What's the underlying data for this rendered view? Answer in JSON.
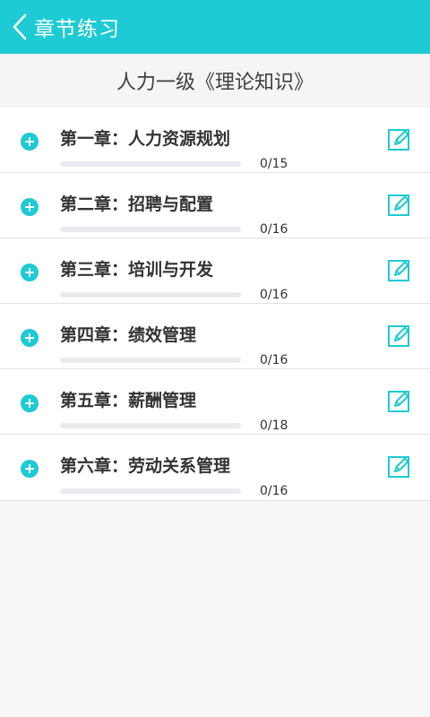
{
  "header": {
    "back_icon": "chevron-left-icon",
    "title": "章节练习"
  },
  "subtitle": "人力一级《理论知识》",
  "colors": {
    "accent": "#1ecad3",
    "background": "#f7f6f9"
  },
  "chapters": [
    {
      "label": "第一章：人力资源规划",
      "progress": "0/15",
      "done": 0,
      "total": 15
    },
    {
      "label": "第二章：招聘与配置",
      "progress": "0/16",
      "done": 0,
      "total": 16
    },
    {
      "label": "第三章：培训与开发",
      "progress": "0/16",
      "done": 0,
      "total": 16
    },
    {
      "label": "第四章：绩效管理",
      "progress": "0/16",
      "done": 0,
      "total": 16
    },
    {
      "label": "第五章：薪酬管理",
      "progress": "0/18",
      "done": 0,
      "total": 18
    },
    {
      "label": "第六章：劳动关系管理",
      "progress": "0/16",
      "done": 0,
      "total": 16
    }
  ]
}
